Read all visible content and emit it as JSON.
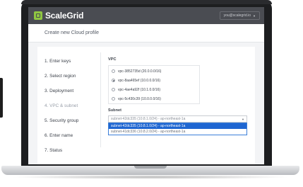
{
  "app": {
    "brand": "ScaleGrid",
    "user_menu": "you@scalegrid.io"
  },
  "page": {
    "title": "Create new Cloud profile"
  },
  "wizard": {
    "steps": [
      {
        "label": "1. Enter keys"
      },
      {
        "label": "2. Select region"
      },
      {
        "label": "3. Deployment"
      },
      {
        "label": "4. VPC & subnet",
        "current": true
      },
      {
        "label": "5. Security group"
      },
      {
        "label": "6. Enter name"
      },
      {
        "label": "7. Status"
      }
    ]
  },
  "vpc": {
    "label": "VPC",
    "options": [
      {
        "label": "vpc-3852735d (20.0.0.0/16)",
        "selected": false
      },
      {
        "label": "vpc-8aa465ef (10.0.0.0/16)",
        "selected": true
      },
      {
        "label": "vpc-4ae4a92f (10.1.0.0/16)",
        "selected": false
      },
      {
        "label": "vpc-5c430c39 (10.0.0.0/16)",
        "selected": false
      }
    ]
  },
  "subnet": {
    "label": "Subnet",
    "value": "subnet-42dc335 (10.8.1.0/24) - ap-northeast-1a",
    "options": [
      {
        "label": "subnet-42dc335 (10.8.1.0/24) - ap-northeast-1a",
        "highlighted": true
      },
      {
        "label": "subnet-41dc336 (10.8.2.0/24) - ap-northeast-1a",
        "highlighted": false
      }
    ]
  },
  "colors": {
    "topbar": "#4a4c52",
    "brand_green": "#8fc641",
    "highlight": "#1f66d1"
  },
  "icons": {
    "logo": "scalegrid-logo-icon",
    "dropdown": "chevron-down-icon",
    "radio": "radio-icon"
  }
}
